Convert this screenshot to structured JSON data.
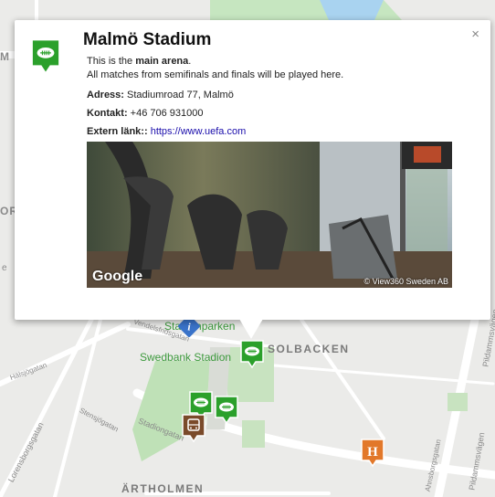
{
  "map": {
    "district_labels": [
      "SOLBACKEN",
      "ÄRTHOLMEN"
    ],
    "edge_labels": [
      "M",
      "OR",
      "e"
    ],
    "park_labels": [
      "Swedbank Stadion",
      "Stadionparken"
    ],
    "streets": [
      "Vendelsfridsgatan",
      "Stadiongatan",
      "Lorensborgsgatan",
      "Hälsjögatan",
      "Stensjögatan",
      "Pildammsvägen",
      "Pildammsvägen",
      "Ahnsborgsgatan"
    ]
  },
  "popup": {
    "title": "Malmö Stadium",
    "close_label": "×",
    "intro_prefix": "This is the ",
    "intro_bold": "main arena",
    "intro_suffix": ".",
    "intro_line2": "All matches from semifinals and finals will be played here.",
    "address_label": "Adress:",
    "address_value": "Stadiumroad 77, Malmö",
    "contact_label": "Kontakt:",
    "contact_value": "+46 706 931000",
    "link_label": "Extern länk::",
    "link_value": "https://www.uefa.com",
    "photo_brand": "Google",
    "photo_credit": "© View360 Sweden AB"
  },
  "colors": {
    "marker_green": "#2ba02b",
    "marker_brown": "#7a4a2a",
    "marker_orange": "#e2782a",
    "marker_blue": "#3a73c9"
  }
}
